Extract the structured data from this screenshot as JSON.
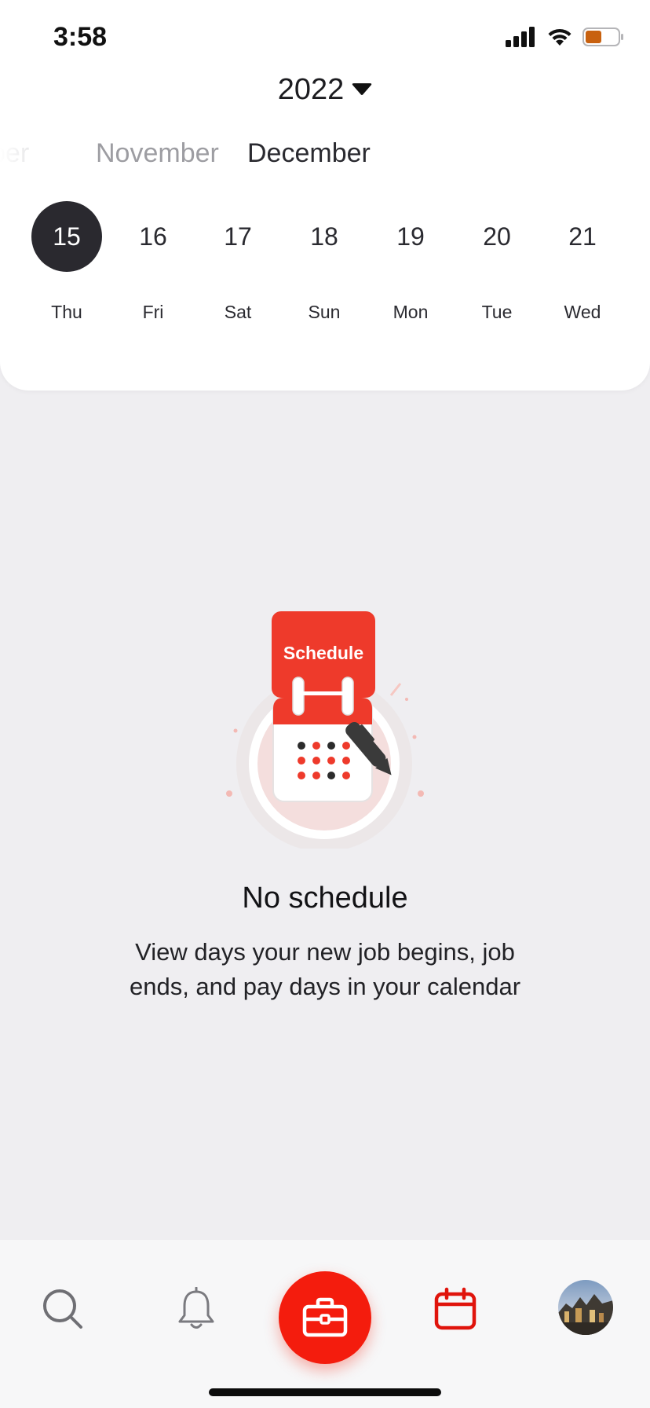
{
  "status_bar": {
    "time": "3:58"
  },
  "calendar": {
    "year": "2022",
    "months": [
      "ber",
      "November",
      "December"
    ],
    "days": [
      {
        "num": "15",
        "name": "Thu"
      },
      {
        "num": "16",
        "name": "Fri"
      },
      {
        "num": "17",
        "name": "Sat"
      },
      {
        "num": "18",
        "name": "Sun"
      },
      {
        "num": "19",
        "name": "Mon"
      },
      {
        "num": "20",
        "name": "Tue"
      },
      {
        "num": "21",
        "name": "Wed"
      }
    ],
    "selected_day": "15"
  },
  "empty_state": {
    "illustration_label": "Schedule",
    "title": "No schedule",
    "description": "View days your new job begins, job ends, and pay days in your calendar"
  },
  "nav": {
    "items": [
      "search-icon",
      "bell-icon",
      "briefcase-icon",
      "calendar-icon",
      "avatar"
    ],
    "active": "calendar-icon"
  },
  "colors": {
    "accent": "#f41c0d",
    "selected_day": "#2a292f",
    "background": "#efeef1"
  }
}
